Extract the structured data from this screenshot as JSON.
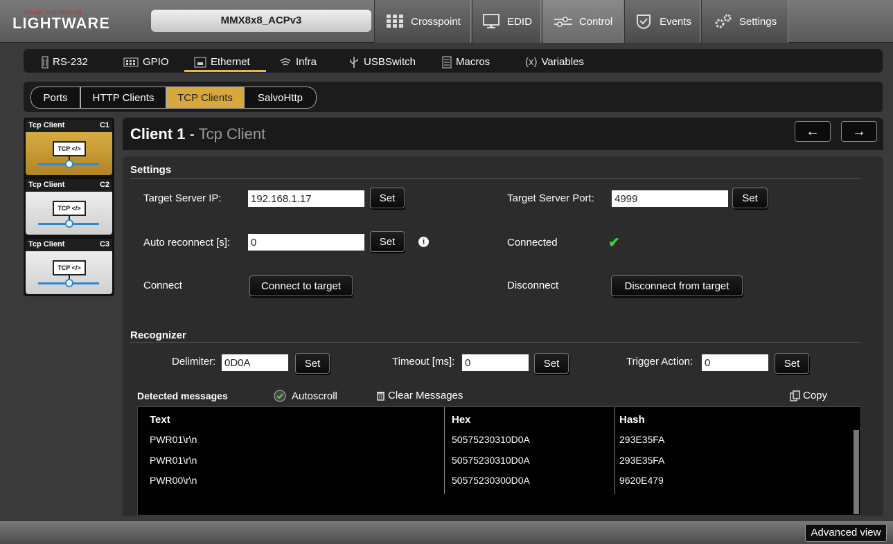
{
  "header": {
    "logo_small": "visual engineering",
    "logo_big": "LIGHTWARE",
    "device_name": "MMX8x8_ACPv3",
    "nav": [
      {
        "label": "Crosspoint",
        "icon": "grid-icon"
      },
      {
        "label": "EDID",
        "icon": "monitor-icon"
      },
      {
        "label": "Control",
        "icon": "sliders-icon",
        "active": true
      },
      {
        "label": "Events",
        "icon": "shield-check-icon"
      },
      {
        "label": "Settings",
        "icon": "gears-icon"
      }
    ]
  },
  "subnav": [
    {
      "label": "RS-232",
      "icon": "serial-port-icon"
    },
    {
      "label": "GPIO",
      "icon": "gpio-icon"
    },
    {
      "label": "Ethernet",
      "icon": "ethernet-icon",
      "active": true
    },
    {
      "label": "Infra",
      "icon": "infrared-icon"
    },
    {
      "label": "USBSwitch",
      "icon": "usb-icon"
    },
    {
      "label": "Macros",
      "icon": "document-icon"
    },
    {
      "label": "Variables",
      "icon": "variable-icon",
      "icon_text": "(x)"
    }
  ],
  "tabs": [
    "Ports",
    "HTTP Clients",
    "TCP Clients",
    "SalvoHttp"
  ],
  "clients": [
    {
      "type": "Tcp Client",
      "id": "C1",
      "box": "TCP </>",
      "active": true
    },
    {
      "type": "Tcp Client",
      "id": "C2",
      "box": "TCP </>"
    },
    {
      "type": "Tcp Client",
      "id": "C3",
      "box": "TCP </>"
    }
  ],
  "panel": {
    "title": "Client 1",
    "subtitle": "Tcp Client",
    "separator": " - ",
    "prev_arrow": "←",
    "next_arrow": "→"
  },
  "settings": {
    "section": "Settings",
    "target_ip_label": "Target Server IP:",
    "target_ip_value": "192.168.1.17",
    "target_port_label": "Target Server Port:",
    "target_port_value": "4999",
    "auto_reconnect_label": "Auto reconnect [s]:",
    "auto_reconnect_value": "0",
    "connected_label": "Connected",
    "connected_mark": "✔",
    "connect_label": "Connect",
    "connect_button": "Connect to target",
    "disconnect_label": "Disconnect",
    "disconnect_button": "Disconnect from target",
    "set_label": "Set",
    "info_glyph": "i"
  },
  "recognizer": {
    "section": "Recognizer",
    "delimiter_label": "Delimiter:",
    "delimiter_value": "0D0A",
    "timeout_label": "Timeout [ms]:",
    "timeout_value": "0",
    "trigger_label": "Trigger Action:",
    "trigger_value": "0",
    "set_label": "Set"
  },
  "messages": {
    "title": "Detected messages",
    "autoscroll_label": "Autoscroll",
    "clear_label": "Clear Messages",
    "copy_label": "Copy",
    "columns": [
      "Text",
      "Hex",
      "Hash"
    ],
    "rows": [
      [
        "PWR01\\r\\n",
        "50575230310D0A",
        "293E35FA"
      ],
      [
        "PWR01\\r\\n",
        "50575230310D0A",
        "293E35FA"
      ],
      [
        "PWR00\\r\\n",
        "50575230300D0A",
        "9620E479"
      ]
    ]
  },
  "footer": {
    "advanced_view": "Advanced view"
  },
  "colors": {
    "accent": "#d7a93c",
    "connected": "#3ccf3c",
    "link_blue": "#2d86d6"
  }
}
